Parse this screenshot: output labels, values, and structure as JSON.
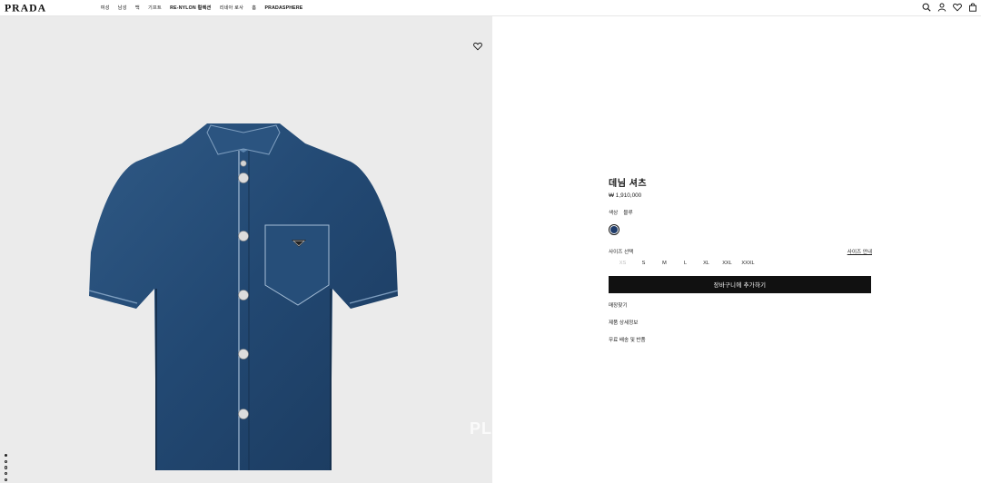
{
  "header": {
    "brand": "PRADA",
    "nav": [
      "여성",
      "남성",
      "백",
      "기프트",
      "RE-NYLON 컬렉션",
      "리네아 로사",
      "홈",
      "PRADASPHERE"
    ]
  },
  "gallery": {
    "watermark": "PL",
    "slide_count": 5,
    "active_slide": 1
  },
  "product": {
    "title": "데님 셔츠",
    "price": "₩ 1,910,000",
    "color_label": "색상",
    "color_value": "블루",
    "color_hex": "#1f3c6b",
    "size_label": "사이즈 선택",
    "size_guide": "사이즈 안내",
    "sizes": [
      "XS",
      "S",
      "M",
      "L",
      "XL",
      "XXL",
      "XXXL"
    ],
    "cart_button": "장바구니에 추가하기",
    "links": [
      "매장찾기",
      "제품 상세정보",
      "무료 배송 및 반품"
    ]
  },
  "colors": {
    "denim_dark": "#1e3e63",
    "denim_mid": "#2d5680",
    "background": "#ebebeb",
    "button": "#111111"
  },
  "icons": [
    "search-icon",
    "account-icon",
    "wishlist-icon",
    "bag-icon",
    "heart-icon"
  ]
}
